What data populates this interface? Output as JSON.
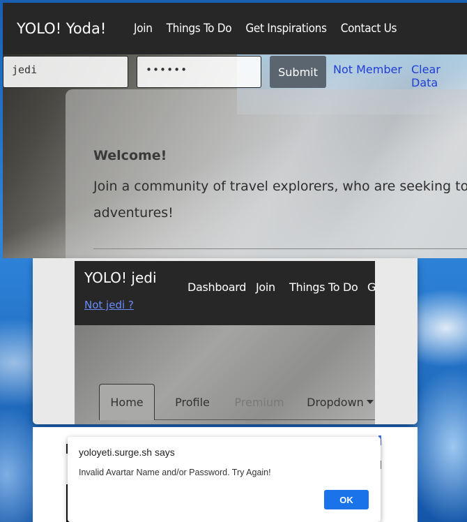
{
  "top": {
    "brand": "YOLO! Yoda!",
    "nav": [
      "Join",
      "Things To Do",
      "Get Inspirations",
      "Contact Us"
    ],
    "login": {
      "username_value": "jedi",
      "password_value": "••••••",
      "submit_label": "Submit",
      "not_member_label": "Not Member",
      "clear_data_label": "Clear Data"
    },
    "welcome": {
      "title": "Welcome!",
      "text_line1": "Join a community of travel explorers, who are seeking to in",
      "text_line2": "adventures!"
    }
  },
  "middle": {
    "brand": "YOLO! jedi",
    "not_user_link": "Not jedi ?",
    "nav": [
      "Dashboard",
      "Join",
      "Things To Do",
      "G"
    ],
    "tabs": {
      "home": "Home",
      "profile": "Profile",
      "premium": "Premium",
      "dropdown": "Dropdown"
    }
  },
  "alert": {
    "title": "yoloyeti.surge.sh says",
    "message": "Invalid Avartar Name and/or Password. Try Again!",
    "ok_label": "OK"
  }
}
